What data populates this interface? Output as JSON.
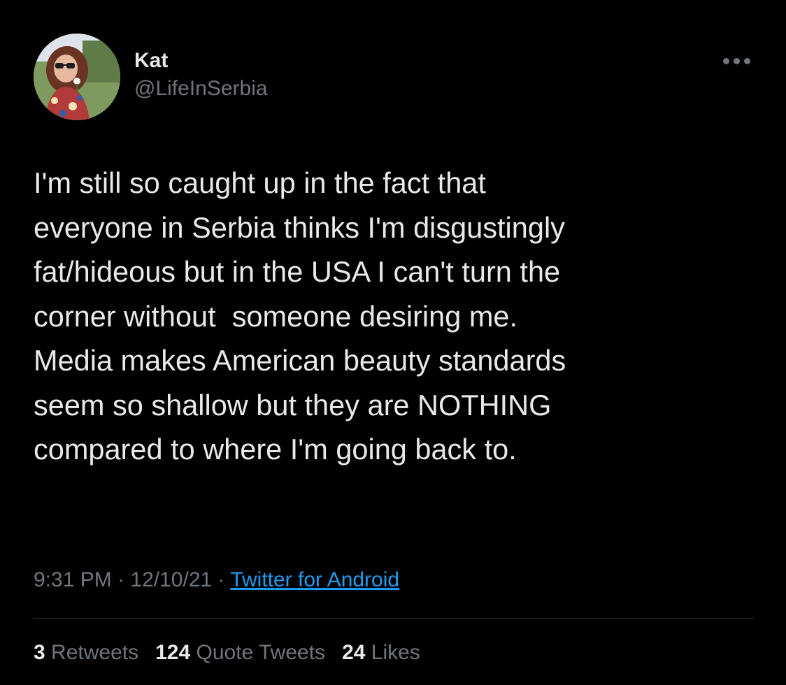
{
  "author": {
    "display_name": "Kat",
    "handle": "@LifeInSerbia"
  },
  "tweet": {
    "lines": [
      "I'm still so caught up in the fact that",
      "everyone in Serbia thinks I'm disgustingly",
      "fat/hideous but in the USA I can't turn the",
      "corner without  someone desiring me.",
      "Media makes American beauty standards",
      "seem so shallow but they are NOTHING",
      "compared to where I'm going back to."
    ]
  },
  "meta": {
    "time": "9:31 PM",
    "sep1": " · ",
    "date": "12/10/21",
    "sep2": " · ",
    "source": "Twitter for Android"
  },
  "stats": {
    "retweets_count": "3",
    "retweets_label": "Retweets",
    "quotes_count": "124",
    "quotes_label": "Quote Tweets",
    "likes_count": "24",
    "likes_label": "Likes"
  },
  "colors": {
    "background": "#000000",
    "text": "#e7e9ea",
    "secondary": "#71767b",
    "link": "#1d9bf0",
    "divider": "#2f3336"
  },
  "icons": {
    "more": "more-horizontal-icon"
  }
}
